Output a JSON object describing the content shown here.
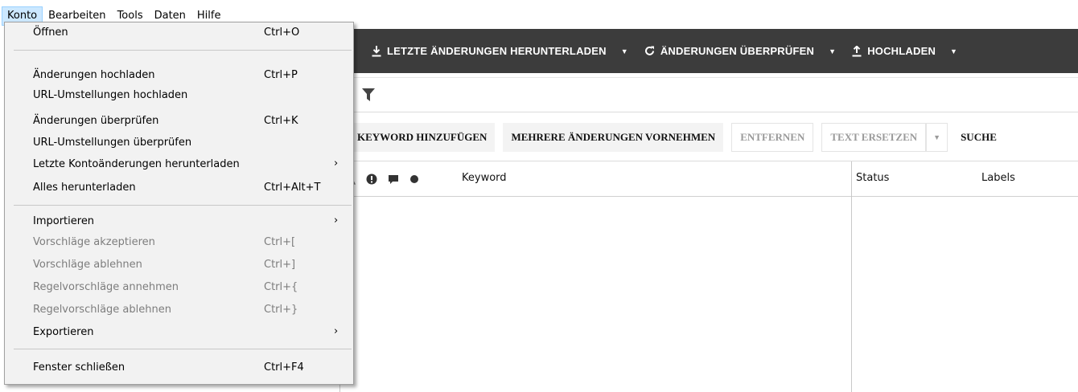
{
  "menubar": [
    "Konto",
    "Bearbeiten",
    "Tools",
    "Daten",
    "Hilfe"
  ],
  "toolbar": {
    "download_label": "LETZTE ÄNDERUNGEN HERUNTERLADEN",
    "check_label": "ÄNDERUNGEN ÜBERPRÜFEN",
    "upload_label": "HOCHLADEN",
    "download_icon": "download-icon",
    "check_icon": "refresh-icon",
    "upload_icon": "upload-icon"
  },
  "actions": {
    "add_keyword": "KEYWORD HINZUFÜGEN",
    "multiple_changes": "MEHRERE ÄNDERUNGEN VORNEHMEN",
    "remove": "ENTFERNEN",
    "replace_text": "TEXT ERSETZEN",
    "search": "SUCHE"
  },
  "grid": {
    "columns": [
      "Keyword",
      "Status",
      "Labels"
    ]
  },
  "menu": {
    "items": [
      {
        "label": "Öffnen",
        "shortcut": "Ctrl+O"
      },
      {
        "label": "Änderungen hochladen",
        "shortcut": "Ctrl+P"
      },
      {
        "label": "URL-Umstellungen hochladen",
        "shortcut": ""
      },
      {
        "label": "Änderungen überprüfen",
        "shortcut": "Ctrl+K"
      },
      {
        "label": "URL-Umstellungen überprüfen",
        "shortcut": ""
      },
      {
        "label": "Letzte Kontoänderungen herunterladen",
        "shortcut": "",
        "submenu": true
      },
      {
        "label": "Alles herunterladen",
        "shortcut": "Ctrl+Alt+T"
      },
      {
        "label": "Importieren",
        "shortcut": "",
        "submenu": true
      },
      {
        "label": "Vorschläge akzeptieren",
        "shortcut": "Ctrl+[",
        "disabled": true
      },
      {
        "label": "Vorschläge ablehnen",
        "shortcut": "Ctrl+]",
        "disabled": true
      },
      {
        "label": "Regelvorschläge annehmen",
        "shortcut": "Ctrl+{",
        "disabled": true
      },
      {
        "label": "Regelvorschläge ablehnen",
        "shortcut": "Ctrl+}",
        "disabled": true
      },
      {
        "label": "Exportieren",
        "shortcut": "",
        "submenu": true
      },
      {
        "label": "Fenster schließen",
        "shortcut": "Ctrl+F4"
      }
    ]
  }
}
